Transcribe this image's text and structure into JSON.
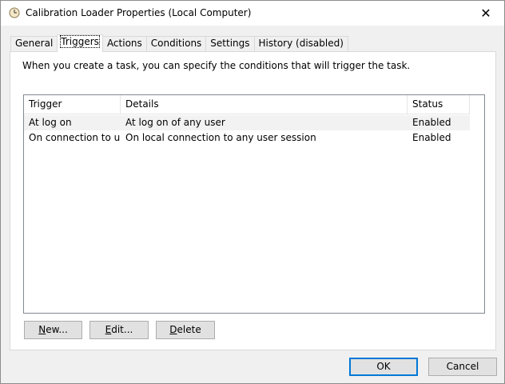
{
  "window": {
    "title": "Calibration Loader Properties (Local Computer)",
    "icon": "task-scheduler-clock-icon",
    "close_glyph": "✕"
  },
  "tabs": [
    {
      "label": "General"
    },
    {
      "label": "Triggers",
      "active": true
    },
    {
      "label": "Actions"
    },
    {
      "label": "Conditions"
    },
    {
      "label": "Settings"
    },
    {
      "label": "History (disabled)"
    }
  ],
  "panel": {
    "description": "When you create a task, you can specify the conditions that will trigger the task."
  },
  "triggers_table": {
    "columns": [
      "Trigger",
      "Details",
      "Status"
    ],
    "rows": [
      {
        "trigger": "At log on",
        "details": "At log on of any user",
        "status": "Enabled",
        "selected": true
      },
      {
        "trigger": "On connection to u...",
        "details": "On local connection to any user session",
        "status": "Enabled",
        "selected": false
      }
    ]
  },
  "panel_buttons": {
    "new": {
      "mnemonic": "N",
      "rest": "ew..."
    },
    "edit": {
      "mnemonic": "E",
      "rest": "dit..."
    },
    "delete": {
      "mnemonic": "D",
      "rest": "elete"
    }
  },
  "dialog_buttons": {
    "ok": "OK",
    "cancel": "Cancel"
  }
}
